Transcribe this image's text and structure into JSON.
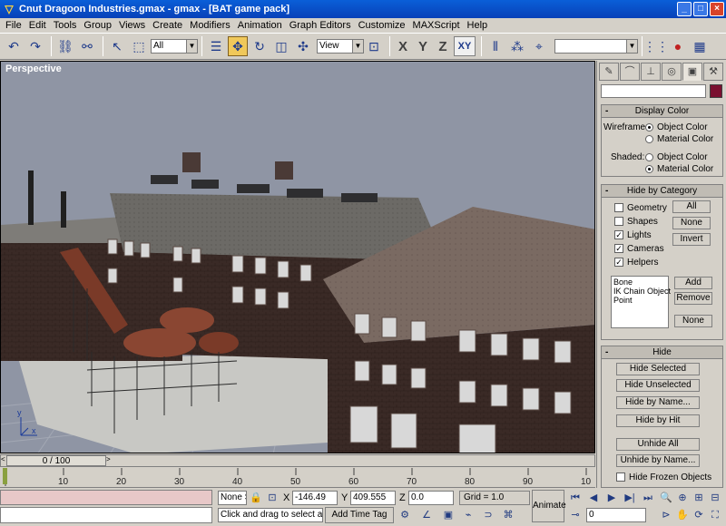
{
  "window": {
    "title": "Cnut Dragoon Industries.gmax - gmax - [BAT game pack]",
    "app_icon": "gmax-logo-icon",
    "buttons": {
      "minimize": "_",
      "maximize": "□",
      "close": "×"
    }
  },
  "menubar": {
    "items": [
      "File",
      "Edit",
      "Tools",
      "Group",
      "Views",
      "Create",
      "Modifiers",
      "Animation",
      "Graph Editors",
      "Customize",
      "MAXScript",
      "Help"
    ]
  },
  "toolbar": {
    "selection_filter": "All",
    "ref_coord": "View",
    "axis_x": "X",
    "axis_y": "Y",
    "axis_z": "Z",
    "axis_xy": "XY",
    "named_selection": ""
  },
  "viewport": {
    "label": "Perspective",
    "axis_labels": {
      "y": "y",
      "x": "x"
    }
  },
  "timeslider": {
    "frame_label": "0 / 100",
    "left_arrow": "<",
    "right_arrow": ">"
  },
  "ruler": {
    "ticks": [
      "10",
      "20",
      "30",
      "40",
      "50",
      "60",
      "70",
      "80",
      "90",
      "10"
    ]
  },
  "status": {
    "selection": "None S",
    "x_label": "X",
    "x_value": "-146.49",
    "y_label": "Y",
    "y_value": "409.555",
    "z_label": "Z",
    "z_value": "0.0",
    "grid": "Grid = 1.0",
    "prompt": "Click and drag to select and m",
    "add_time_tag": "Add Time Tag",
    "animate": "Animate",
    "frame": "0"
  },
  "command_panel": {
    "display_color": {
      "title": "Display Color",
      "wireframe_label": "Wireframe:",
      "shaded_label": "Shaded:",
      "object_color": "Object Color",
      "material_color": "Material Color"
    },
    "hide_by_category": {
      "title": "Hide by Category",
      "geometry": "Geometry",
      "shapes": "Shapes",
      "lights": "Lights",
      "cameras": "Cameras",
      "helpers": "Helpers",
      "all_btn": "All",
      "none_btn": "None",
      "invert_btn": "Invert",
      "list": [
        "Bone",
        "IK Chain Object",
        "Point"
      ],
      "add_btn": "Add",
      "remove_btn": "Remove",
      "none_btn2": "None"
    },
    "hide": {
      "title": "Hide",
      "hide_selected": "Hide Selected",
      "hide_unselected": "Hide Unselected",
      "hide_by_name": "Hide by Name...",
      "hide_by_hit": "Hide by Hit",
      "unhide_all": "Unhide All",
      "unhide_by_name": "Unhide by Name...",
      "hide_frozen": "Hide Frozen Objects"
    }
  },
  "colors": {
    "titlebar": "#0a5fd8",
    "viewport_bg": "#8f95a4",
    "swatch": "#7a1030"
  }
}
